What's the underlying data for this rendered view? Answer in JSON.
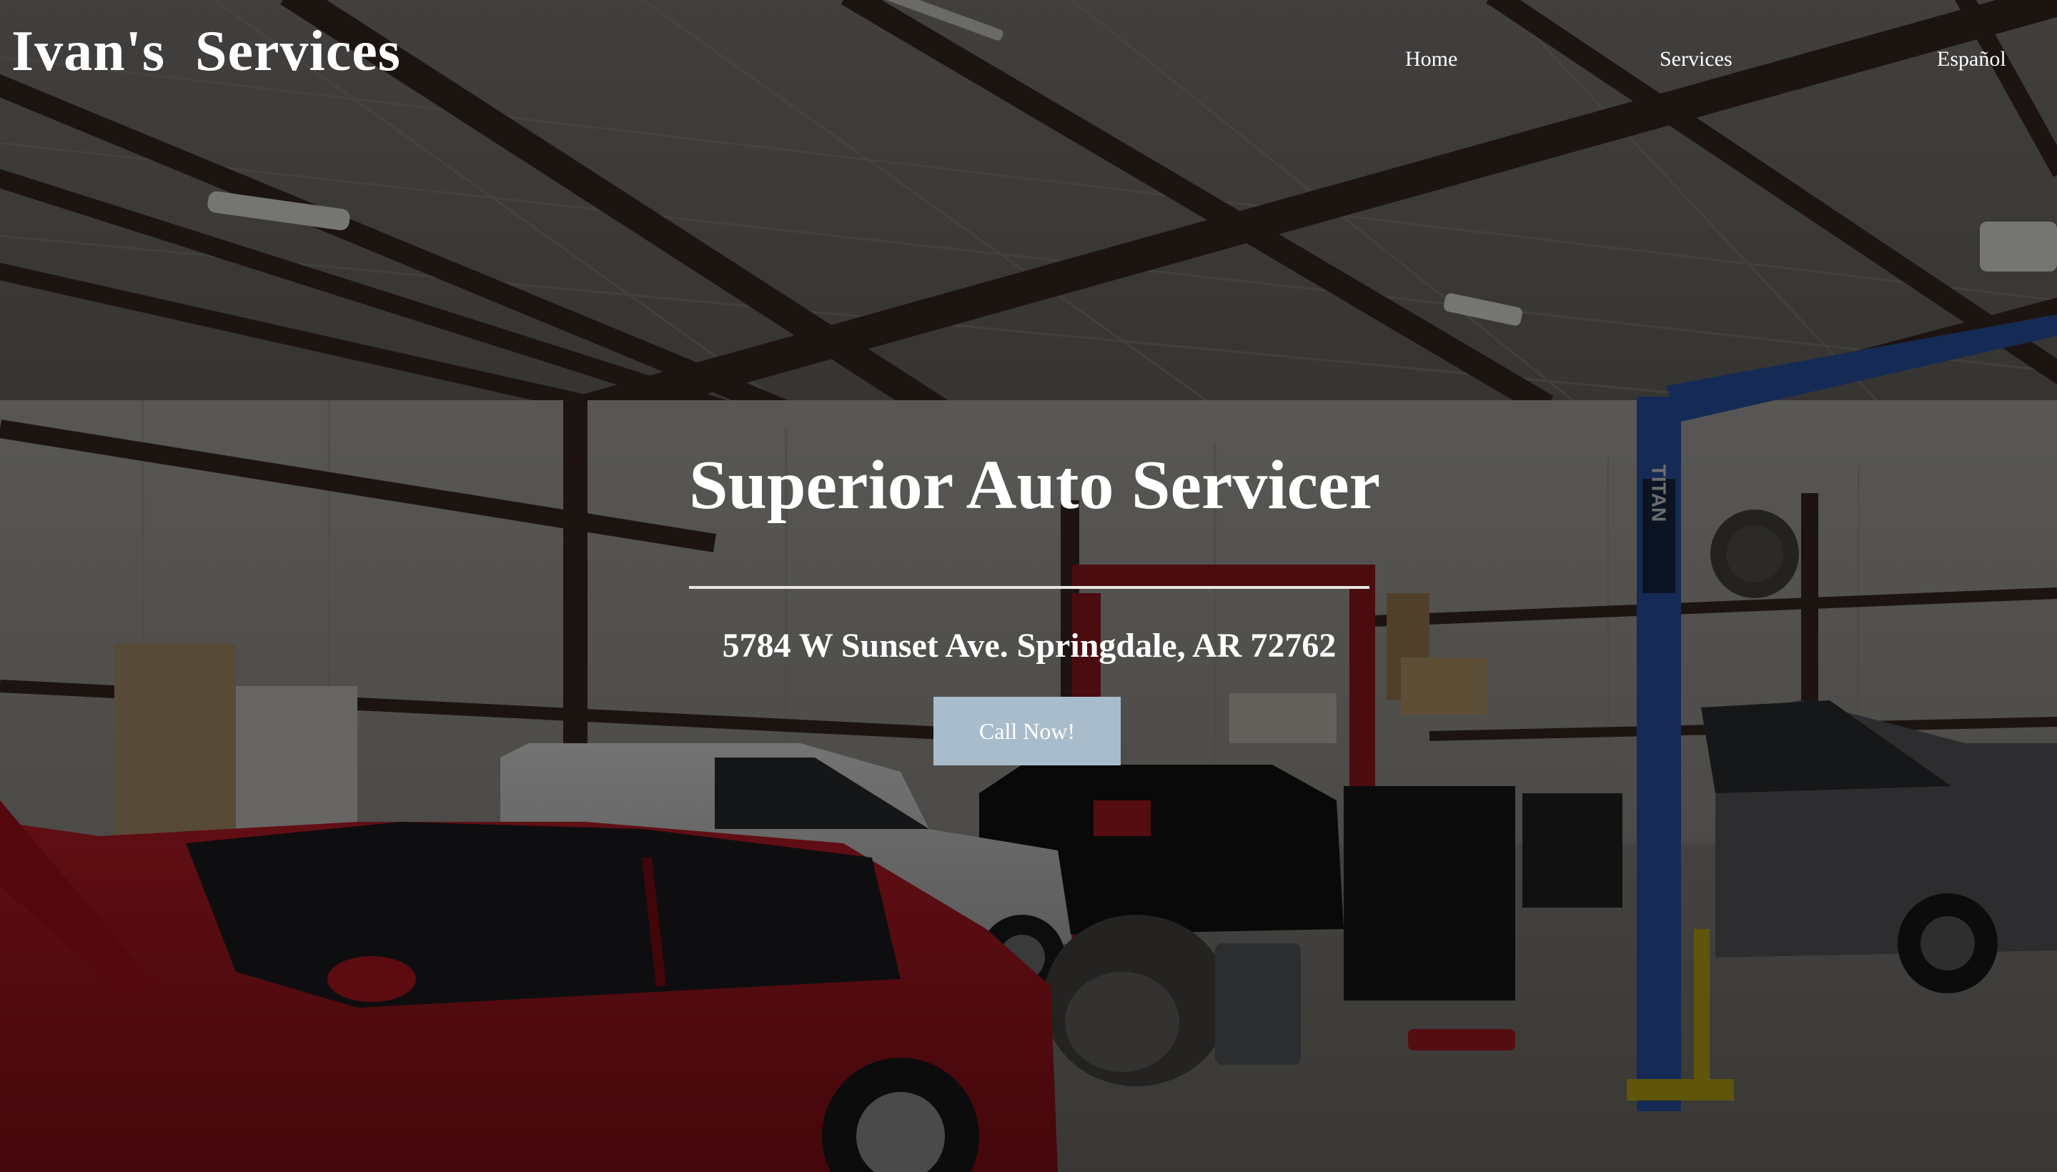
{
  "header": {
    "brand": "Ivan's  Services",
    "nav": [
      {
        "label": "Home"
      },
      {
        "label": "Services"
      },
      {
        "label": "Español"
      }
    ]
  },
  "hero": {
    "title": "Superior Auto Servicer",
    "address": "5784 W Sunset Ave. Springdale, AR 72762",
    "cta_label": "Call Now!"
  },
  "background": {
    "description_icon": "garage-photo",
    "lift_brand": "TITAN"
  },
  "colors": {
    "cta_background": "#a9bccb",
    "overlay": "#000000",
    "text": "#ffffff"
  }
}
